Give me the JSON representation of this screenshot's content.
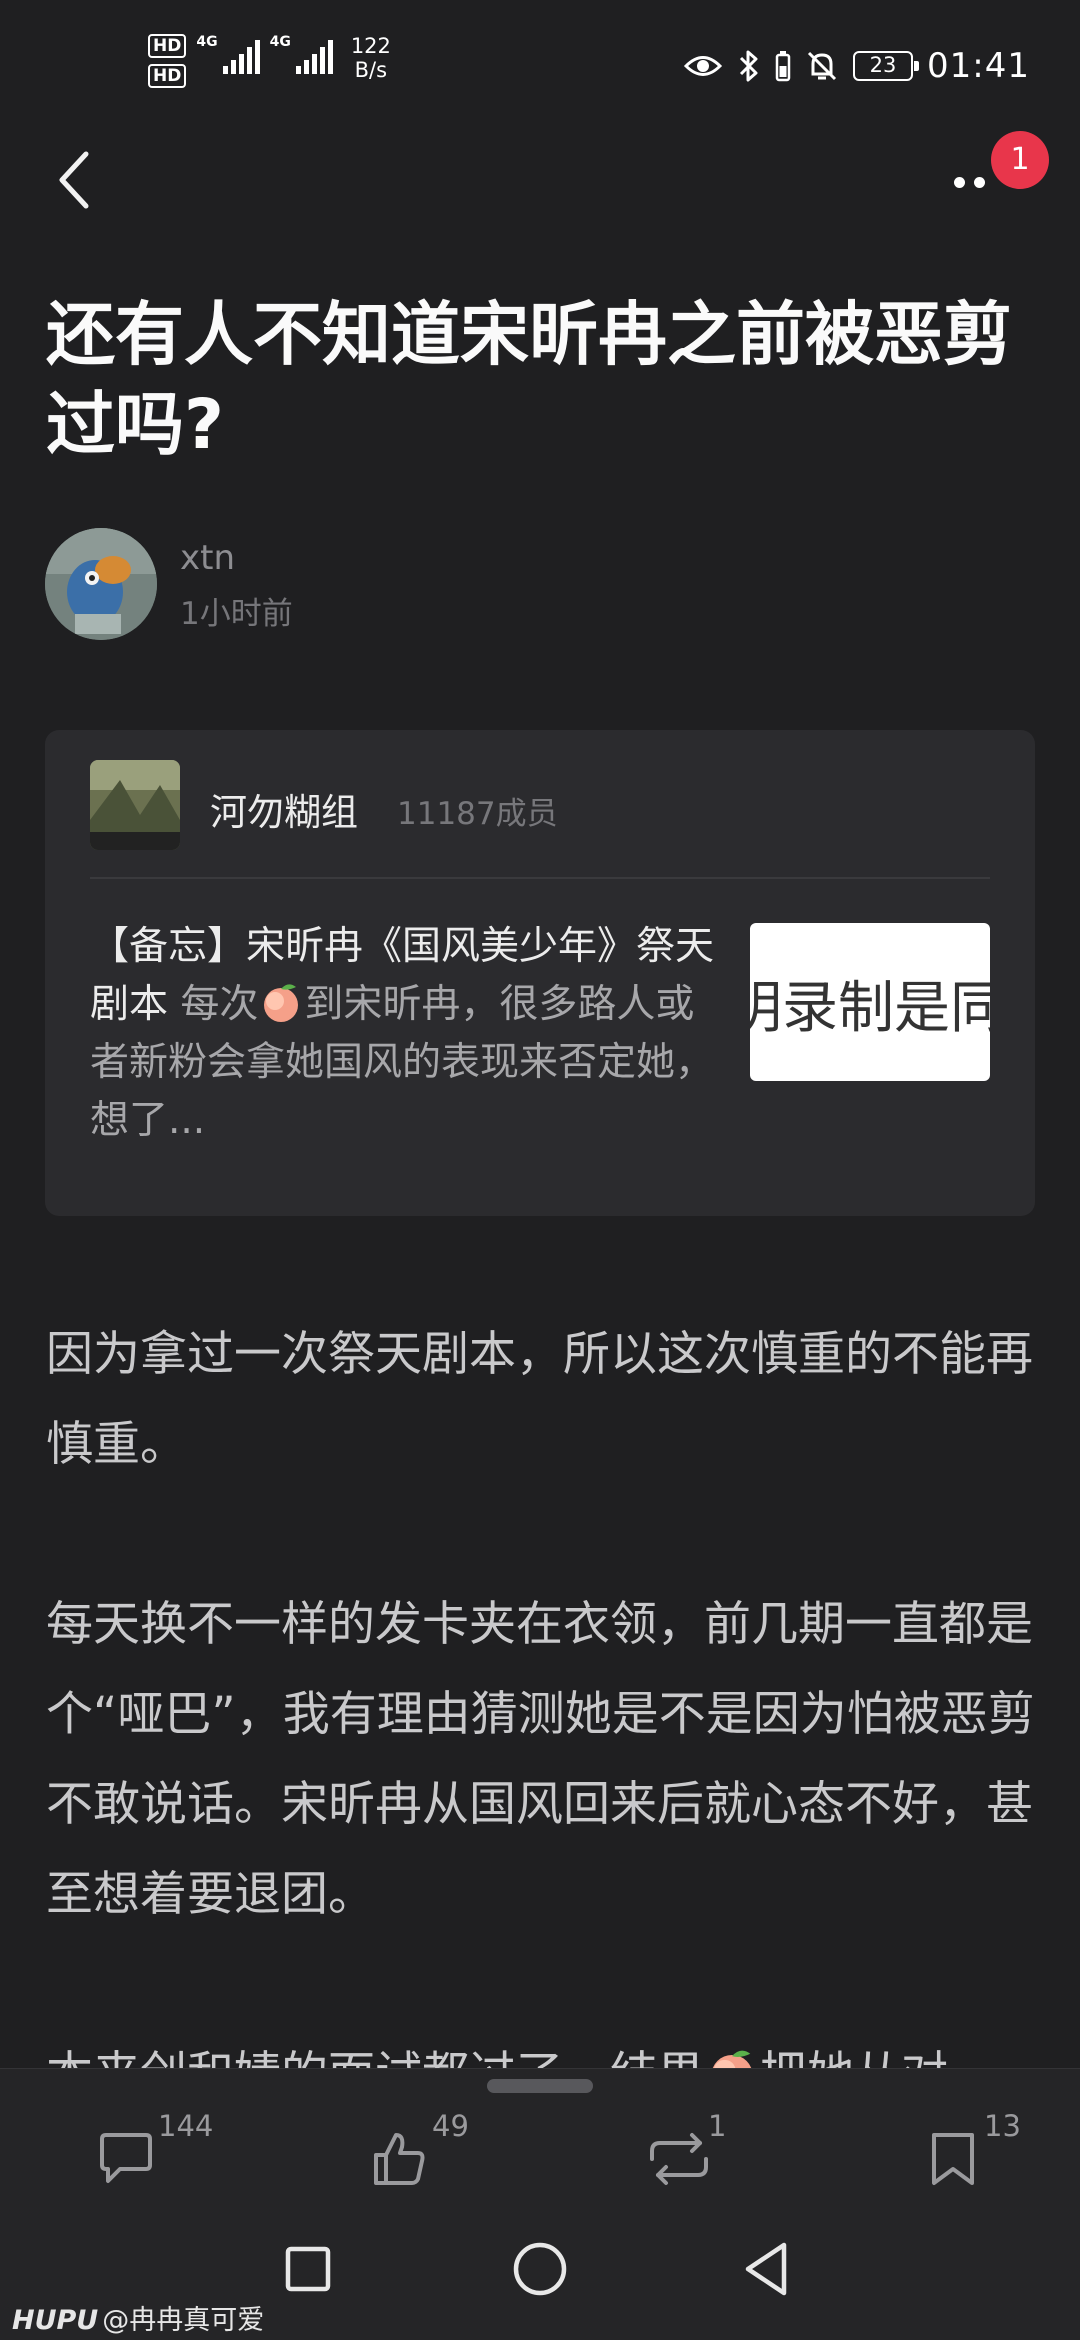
{
  "status_bar": {
    "hd1": "HD",
    "hd2": "HD",
    "net1": "4G",
    "net2": "4G",
    "speed_value": "122",
    "speed_unit": "B/s",
    "battery": "23",
    "time": "01:41"
  },
  "nav": {
    "back_icon": "chevron-left-icon",
    "more_icon": "more-dots-icon",
    "notification_count": "1"
  },
  "post": {
    "title": "还有人不知道宋昕冉之前被恶剪过吗?",
    "author": "xtn",
    "time": "1小时前"
  },
  "quoted_card": {
    "group_name": "河勿糊组",
    "group_members": "11187成员",
    "text_title": "【备忘】宋昕冉《国风美少年》祭天剧本",
    "text_snippet_a": " 每次",
    "text_snippet_b": "到宋昕冉，很多路人或者新粉会拿她国风的表现来否定她，想了...",
    "image_text": "明录制是同"
  },
  "body": {
    "p1": "因为拿过一次祭天剧本，所以这次慎重的不能再慎重。",
    "p2": "每天换不一样的发卡夹在衣领，前几期一直都是个“哑巴”，我有理由猜测她是不是因为怕被恶剪不敢说话。宋昕冉从国风回来后就心态不好，甚至想着要退团。",
    "p3a": "本来创和婧的面试都过了，结果",
    "p3b": "把她从对"
  },
  "actions": {
    "comments": "144",
    "likes": "49",
    "reposts": "1",
    "bookmarks": "13"
  },
  "watermark": {
    "brand": "HUPU",
    "user": "@冉冉真可爱"
  },
  "colors": {
    "background": "#1f1f21",
    "card": "#2b2b2e",
    "badge": "#e8364b"
  }
}
